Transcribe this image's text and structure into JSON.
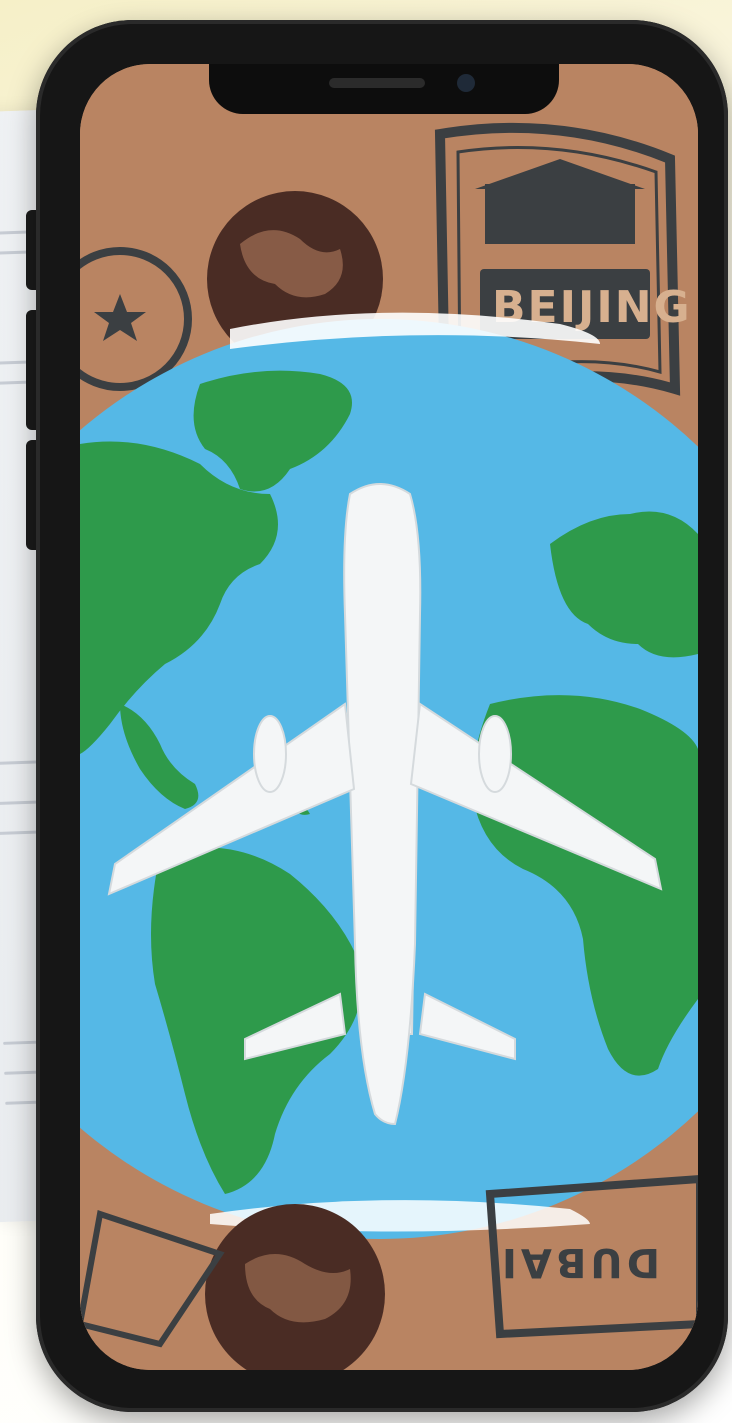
{
  "image": {
    "type": "smartphone-mockup",
    "stamps": [
      {
        "text": "BEIJING"
      },
      {
        "text": "DUBAI"
      }
    ],
    "colors": {
      "frame": "#161616",
      "cardboard": "#b98462",
      "ocean": "#55b8e6",
      "land": "#2e9a4b",
      "airplane": "#f4f6f7",
      "stamp_ink": "#3b3f42"
    }
  }
}
